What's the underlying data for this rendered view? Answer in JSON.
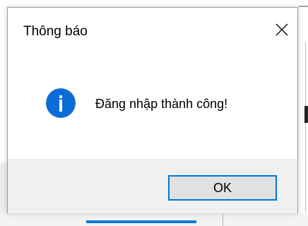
{
  "dialog": {
    "title": "Thông báo",
    "message": "Đăng nhập thành công!",
    "ok_label": "OK",
    "icon": "info-icon",
    "close_icon": "close-icon"
  },
  "colors": {
    "accent": "#0078d7",
    "footer_bg": "#f0f0f0",
    "button_bg": "#e1e1e1"
  }
}
